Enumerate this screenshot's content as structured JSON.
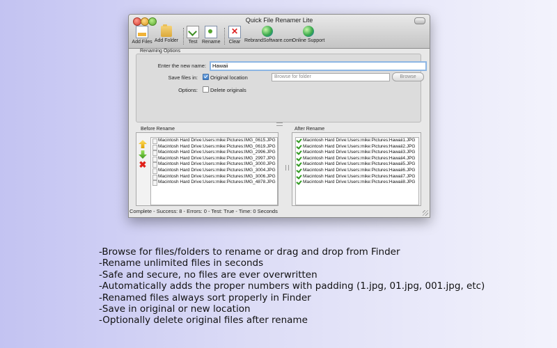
{
  "window": {
    "title": "Quick File Renamer Lite"
  },
  "toolbar": [
    {
      "label": "Add Files",
      "icon": "add-files-icon"
    },
    {
      "label": "Add Folder",
      "icon": "folder-icon"
    },
    {
      "label": "Test",
      "icon": "test-icon"
    },
    {
      "label": "Rename",
      "icon": "rename-icon"
    },
    {
      "label": "Clear",
      "icon": "clear-icon"
    },
    {
      "label": "RebrandSoftware.com",
      "icon": "globe-icon"
    },
    {
      "label": "Online Support",
      "icon": "globe-icon"
    }
  ],
  "options": {
    "group_title": "Renaming Options",
    "new_name_label": "Enter the new name:",
    "new_name_value": "Hawaii",
    "save_label": "Save files in:",
    "original_location_label": "Original location",
    "original_location_checked": true,
    "folder_placeholder": "Browse for folder",
    "browse_label": "Browse",
    "options_label": "Options:",
    "delete_originals_label": "Delete originals",
    "delete_originals_checked": false
  },
  "before": {
    "title": "Before Rename",
    "files": [
      "Macintosh Hard Drive:Users:mike:Pictures:IMG_0615.JPG",
      "Macintosh Hard Drive:Users:mike:Pictures:IMG_0619.JPG",
      "Macintosh Hard Drive:Users:mike:Pictures:IMG_2996.JPG",
      "Macintosh Hard Drive:Users:mike:Pictures:IMG_2997.JPG",
      "Macintosh Hard Drive:Users:mike:Pictures:IMG_3000.JPG",
      "Macintosh Hard Drive:Users:mike:Pictures:IMG_3004.JPG",
      "Macintosh Hard Drive:Users:mike:Pictures:IMG_3006.JPG",
      "Macintosh Hard Drive:Users:mike:Pictures:IMG_4878.JPG"
    ]
  },
  "after": {
    "title": "After Rename",
    "files": [
      "Macintosh Hard Drive:Users:mike:Pictures:Hawaii1.JPG",
      "Macintosh Hard Drive:Users:mike:Pictures:Hawaii2.JPG",
      "Macintosh Hard Drive:Users:mike:Pictures:Hawaii3.JPG",
      "Macintosh Hard Drive:Users:mike:Pictures:Hawaii4.JPG",
      "Macintosh Hard Drive:Users:mike:Pictures:Hawaii5.JPG",
      "Macintosh Hard Drive:Users:mike:Pictures:Hawaii6.JPG",
      "Macintosh Hard Drive:Users:mike:Pictures:Hawaii7.JPG",
      "Macintosh Hard Drive:Users:mike:Pictures:Hawaii8.JPG"
    ]
  },
  "status": "Complete - Success: 8 - Errors: 0 - Test: True - Time: 0 Seconds",
  "features": [
    "-Browse for files/folders to rename or drag and drop from Finder",
    "-Rename unlimited files in seconds",
    "-Safe and secure, no files are ever overwritten",
    "-Automatically adds the proper numbers with padding (1.jpg, 01.jpg, 001.jpg, etc)",
    "-Renamed files always sort properly in Finder",
    "-Save in original or new location",
    "-Optionally delete original files after rename"
  ],
  "colors": {
    "accent_check": "#2f9a1f",
    "delete_red": "#e0201a",
    "focus_ring": "#8db6e4"
  }
}
